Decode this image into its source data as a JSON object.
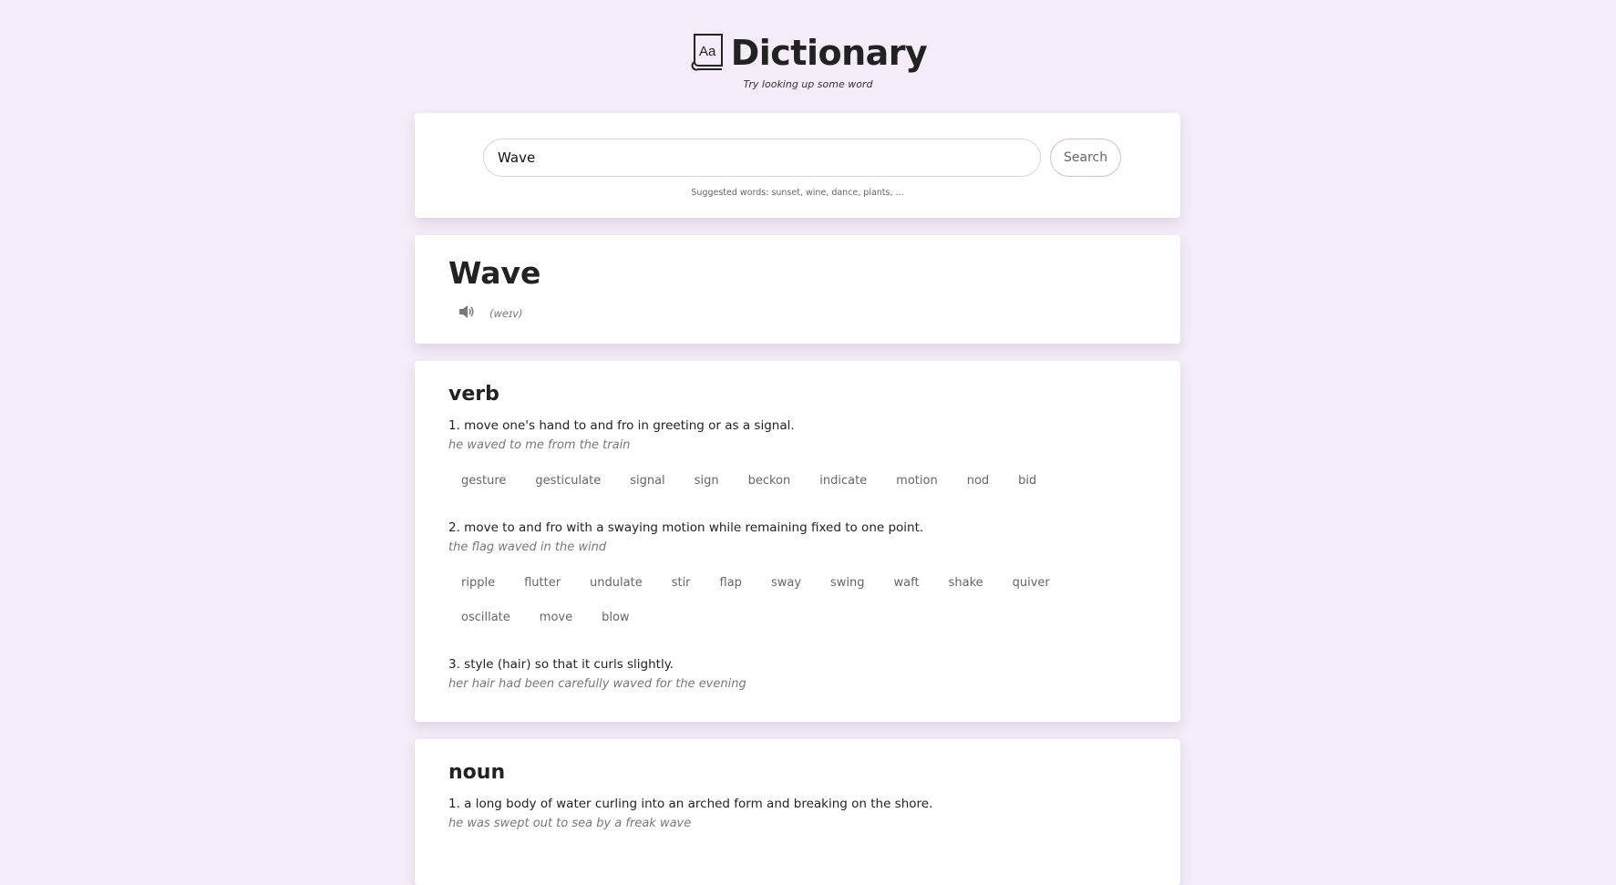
{
  "header": {
    "title": "Dictionary",
    "tagline": "Try looking up some word",
    "logo_icon": "book-aa-icon"
  },
  "search": {
    "value": "Wave",
    "placeholder": "",
    "button_label": "Search",
    "suggestions": "Suggested words: sunset, wine, dance, plants, ..."
  },
  "entry": {
    "word": "Wave",
    "audio_icon": "speaker-icon",
    "phonetic": "(weɪv)"
  },
  "verb": {
    "pos": "verb",
    "meanings": [
      {
        "definition": "1. move one's hand to and fro in greeting or as a signal.",
        "example": "he waved to me from the train",
        "synonyms": [
          "gesture",
          "gesticulate",
          "signal",
          "sign",
          "beckon",
          "indicate",
          "motion",
          "nod",
          "bid"
        ]
      },
      {
        "definition": "2. move to and fro with a swaying motion while remaining fixed to one point.",
        "example": "the flag waved in the wind",
        "synonyms": [
          "ripple",
          "flutter",
          "undulate",
          "stir",
          "flap",
          "sway",
          "swing",
          "waft",
          "shake",
          "quiver",
          "oscillate",
          "move",
          "blow"
        ]
      },
      {
        "definition": "3. style (hair) so that it curls slightly.",
        "example": "her hair had been carefully waved for the evening",
        "synonyms": []
      }
    ]
  },
  "noun": {
    "pos": "noun",
    "meanings": [
      {
        "definition": "1. a long body of water curling into an arched form and breaking on the shore.",
        "example": "he was swept out to sea by a freak wave",
        "synonyms": []
      }
    ]
  }
}
